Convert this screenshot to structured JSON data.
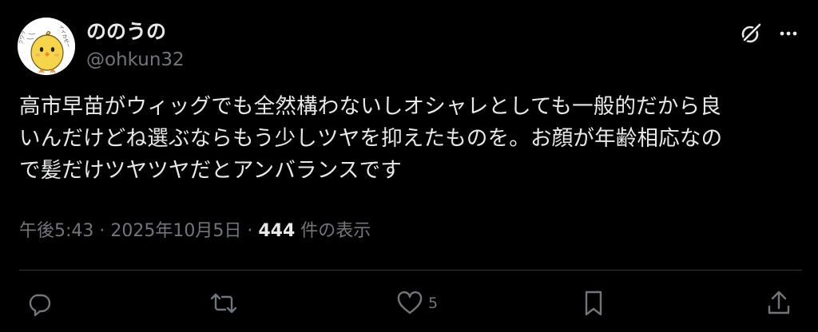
{
  "author": {
    "display_name": "ののうの",
    "handle": "@ohkun32"
  },
  "tweet": {
    "lines": [
      "高市早苗がウィッグでも全然構わないしオシャレとしても一般的だから良",
      "いんだけどね選ぶならもう少しツヤを抑えたものを。お顔が年齢相応なの",
      "で髪だけツヤツヤだとアンバランスです"
    ]
  },
  "meta": {
    "time": "午後5:43",
    "separator": " · ",
    "date": "2025年10月5日",
    "views_count": "444",
    "views_label": " 件の表示"
  },
  "actions": {
    "like_count": "5"
  },
  "avatar_text": {
    "top": "イイカゼー",
    "side": "フワッ"
  },
  "colors": {
    "background": "#000000",
    "primary_text": "#e7e9ea",
    "secondary_text": "#71767b",
    "divider": "#2f3336"
  },
  "icons": {
    "grok": "grok-icon",
    "more": "more-dots-icon",
    "reply": "reply-icon",
    "retweet": "retweet-icon",
    "like": "heart-icon",
    "bookmark": "bookmark-icon",
    "share": "share-icon"
  }
}
